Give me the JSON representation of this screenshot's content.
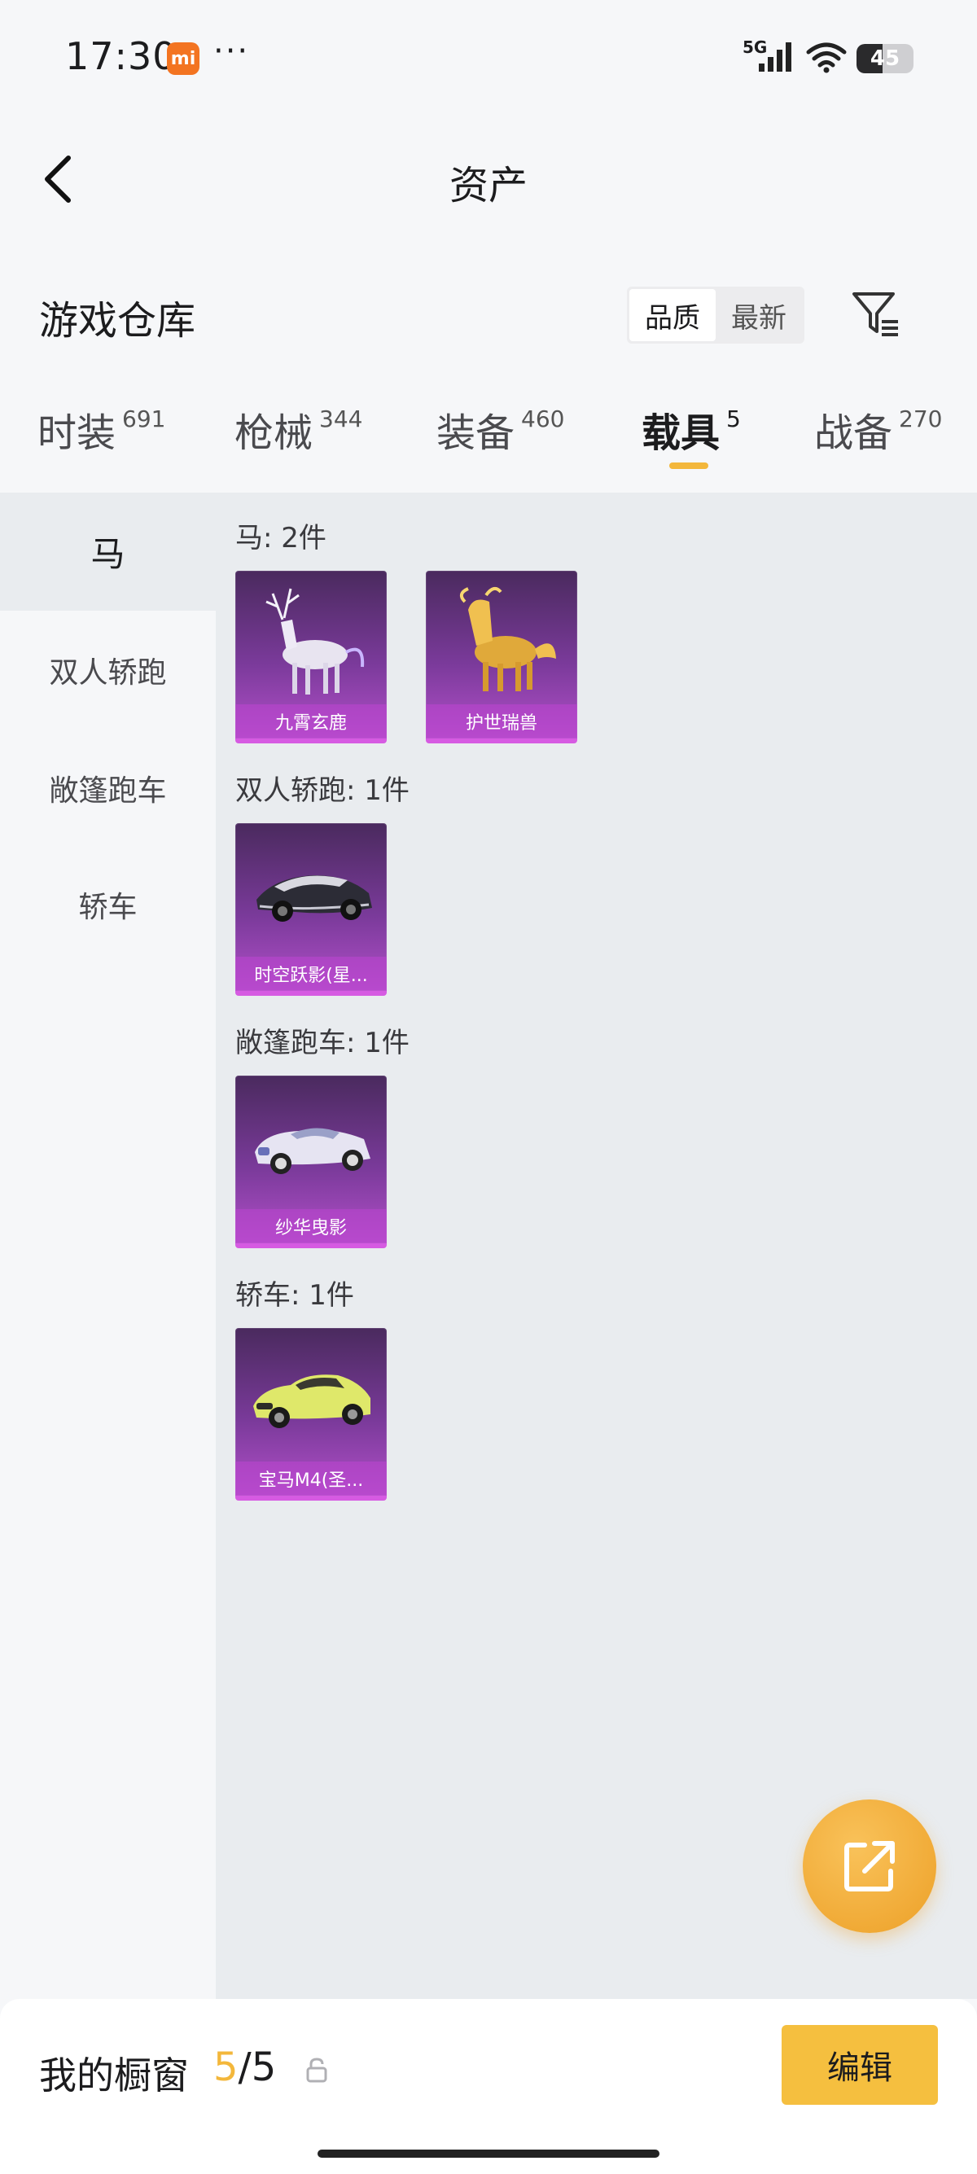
{
  "status": {
    "time": "17:30",
    "network": "5G",
    "battery": "45",
    "battery_fraction": 0.45,
    "app_badge_icon": "mi-icon",
    "more_icon": "more-dots-icon"
  },
  "nav": {
    "title": "资产",
    "back_icon": "back-chevron-icon"
  },
  "section": {
    "title": "游戏仓库",
    "sort": [
      "品质",
      "最新"
    ],
    "filter_icon": "filter-icon"
  },
  "tabs": [
    {
      "label": "时装",
      "count": "691"
    },
    {
      "label": "枪械",
      "count": "344"
    },
    {
      "label": "装备",
      "count": "460"
    },
    {
      "label": "载具",
      "count": "5",
      "active": true
    },
    {
      "label": "战备",
      "count": "270"
    }
  ],
  "sidebar": [
    "马",
    "双人轿跑",
    "敞篷跑车",
    "轿车"
  ],
  "groups": [
    {
      "title": "马: 2件",
      "items": [
        "九霄玄鹿",
        "护世瑞兽"
      ]
    },
    {
      "title": "双人轿跑: 1件",
      "items": [
        "时空跃影(星..."
      ]
    },
    {
      "title": "敞篷跑车: 1件",
      "items": [
        "纱华曳影"
      ]
    },
    {
      "title": "轿车: 1件",
      "items": [
        "宝马M4(圣..."
      ]
    }
  ],
  "fab_icon": "share-external-icon",
  "bottom": {
    "label": "我的橱窗",
    "current": "5",
    "sep_total": "/5",
    "lock_icon": "lock-icon",
    "edit": "编辑"
  },
  "colors": {
    "accent": "#f3b73b",
    "card_purple": "#7a3a9a",
    "fab": "#eda027"
  }
}
